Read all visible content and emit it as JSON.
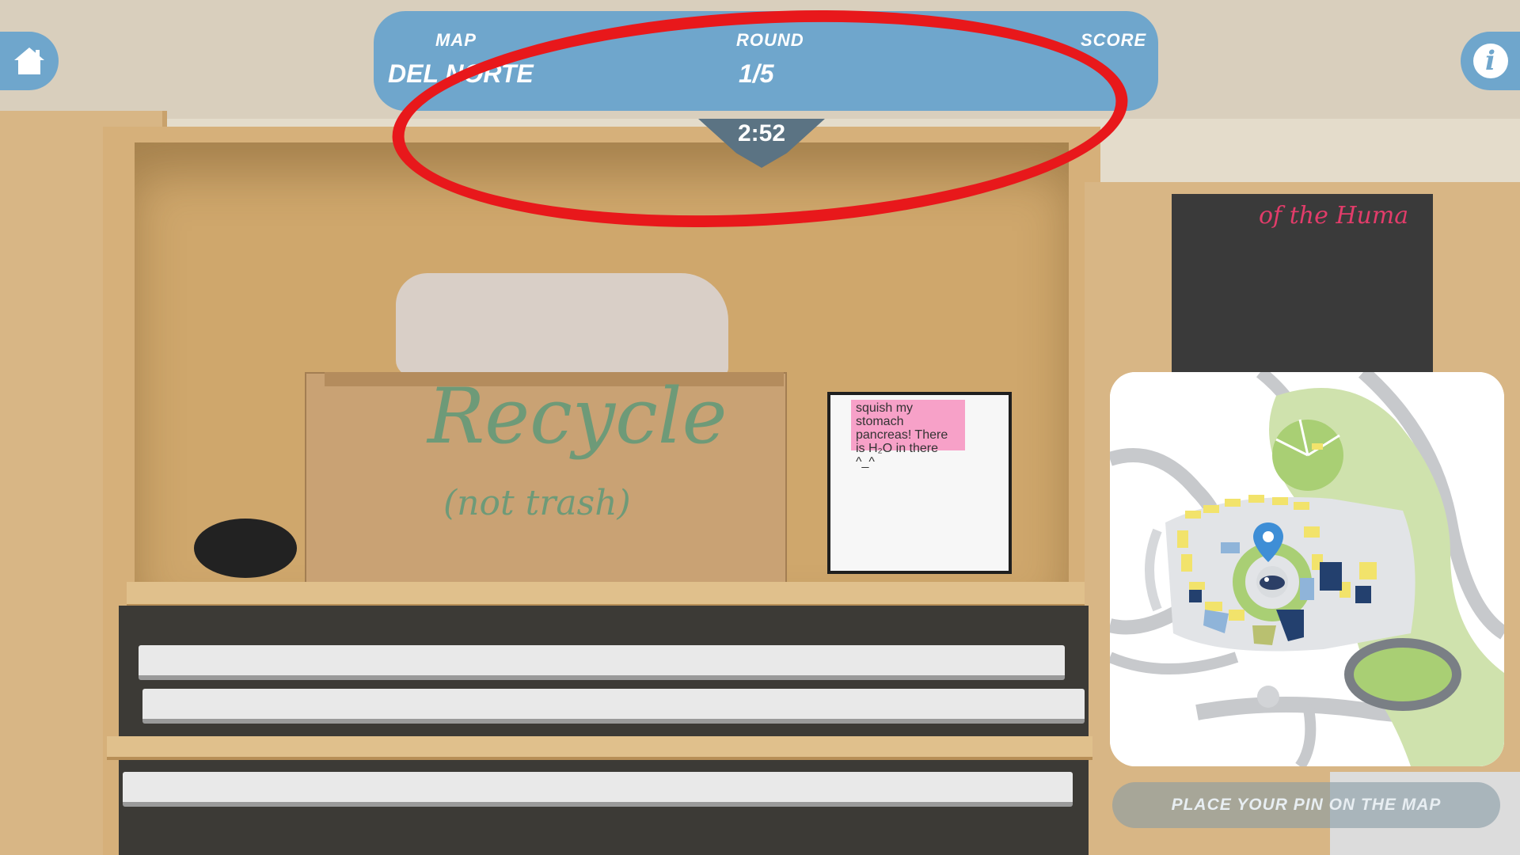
{
  "hud": {
    "map_label": "MAP",
    "map_value": "DEL NORTE",
    "round_label": "ROUND",
    "round_value": "1/5",
    "score_label": "SCORE",
    "timer": "2:52"
  },
  "buttons": {
    "home_icon": "home-icon",
    "info_glyph": "i"
  },
  "photo": {
    "box_word": "Recycle",
    "box_subtext": "(not trash)",
    "sticky_note": "squish my stomach pancreas! There is H₂O in there",
    "sticky_face": "^_^",
    "poster_title": "of the Huma"
  },
  "minimap": {
    "pin_icon": "map-pin-icon",
    "logo_icon": "hawk-logo-icon"
  },
  "place_pin_label": "PLACE YOUR PIN ON THE MAP",
  "colors": {
    "hud_blue": "#6fa6cc",
    "timer_slate": "#5b7383",
    "annotation_red": "#e8181b",
    "pin_blue": "#3e8ed6"
  }
}
